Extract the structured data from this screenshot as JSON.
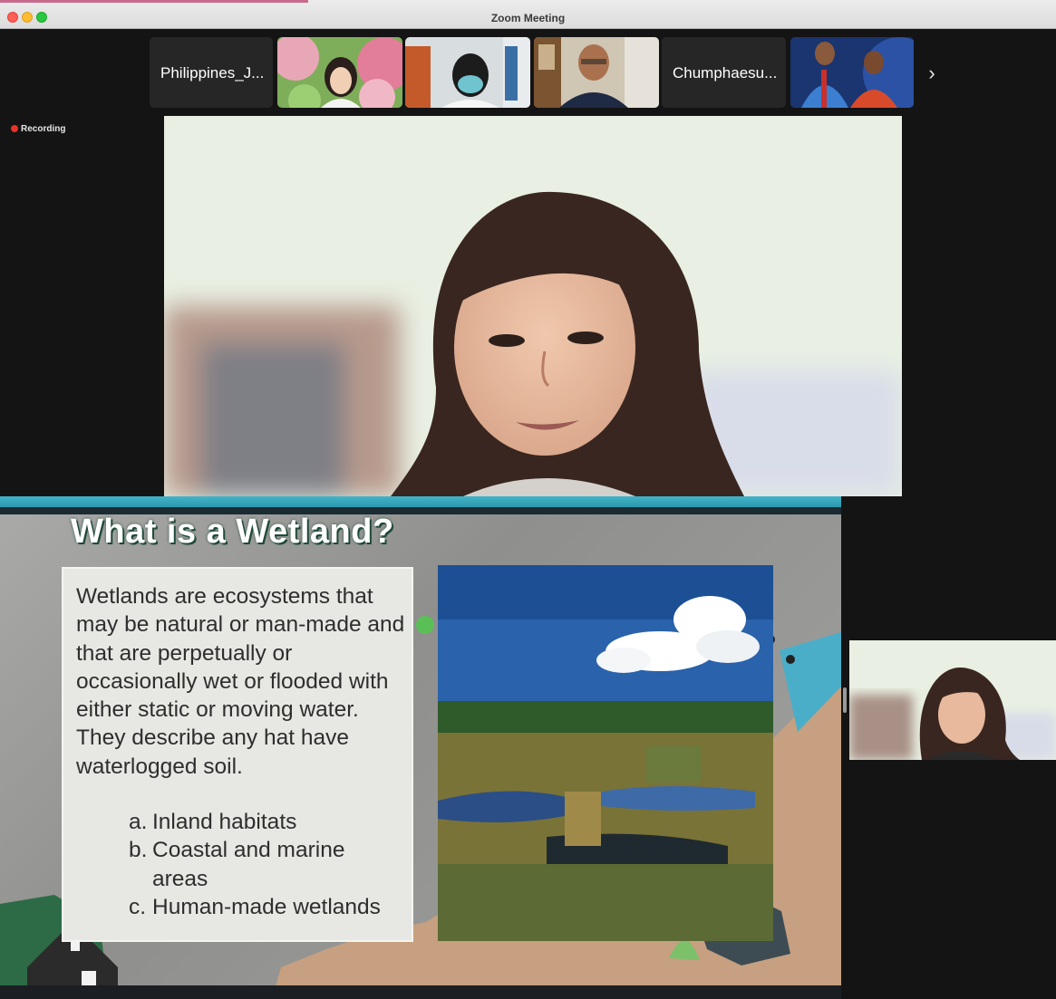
{
  "window": {
    "title": "Zoom Meeting"
  },
  "participants": [
    {
      "name": "Philippines_J...",
      "type": "name"
    },
    {
      "name": "",
      "type": "video",
      "desc": "woman-with-roses"
    },
    {
      "name": "",
      "type": "video",
      "desc": "student-with-mask"
    },
    {
      "name": "",
      "type": "video",
      "desc": "older-man"
    },
    {
      "name": "Chumphaesu...",
      "type": "name"
    },
    {
      "name": "",
      "type": "video",
      "desc": "two-boys"
    }
  ],
  "strip": {
    "next_icon": "chevron-right-icon",
    "next_glyph": "›"
  },
  "recording": {
    "label": "Recording",
    "color": "#e5322b"
  },
  "slide": {
    "title": "What is a Wetland?",
    "paragraph": "Wetlands are ecosystems that may be natural or man-made and that are perpetually or occasionally wet or flooded with either static or moving water. They describe any hat have waterlogged soil.",
    "list": [
      {
        "marker": "a.",
        "text": "Inland habitats"
      },
      {
        "marker": "b.",
        "text": "Coastal and marine areas"
      },
      {
        "marker": "c.",
        "text": "Human-made wetlands"
      }
    ]
  },
  "colors": {
    "background": "#141414",
    "titlebar": "#dcdcdc",
    "slide_accent": "#1f8aa0"
  }
}
